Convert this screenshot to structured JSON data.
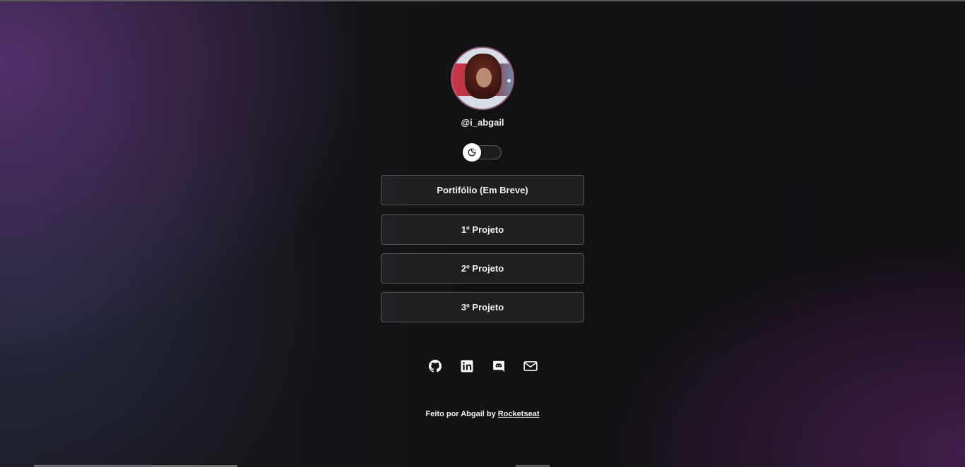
{
  "profile": {
    "username": "@i_abgail"
  },
  "theme_toggle": {
    "icon": "moon-sun-icon"
  },
  "links": [
    {
      "label": "Portifólio (Em Breve)"
    },
    {
      "label": "1º Projeto"
    },
    {
      "label": "2º Projeto"
    },
    {
      "label": "3º Projeto"
    }
  ],
  "socials": [
    {
      "icon": "github-icon"
    },
    {
      "icon": "linkedin-icon"
    },
    {
      "icon": "discord-icon"
    },
    {
      "icon": "mail-icon"
    }
  ],
  "footer": {
    "text": "Feito por Abgail by ",
    "link_label": "Rocketseat"
  },
  "colors": {
    "background": "#121214",
    "accent_purple": "#5c3478",
    "text": "#f1f1f4",
    "button_border": "#56565c"
  }
}
